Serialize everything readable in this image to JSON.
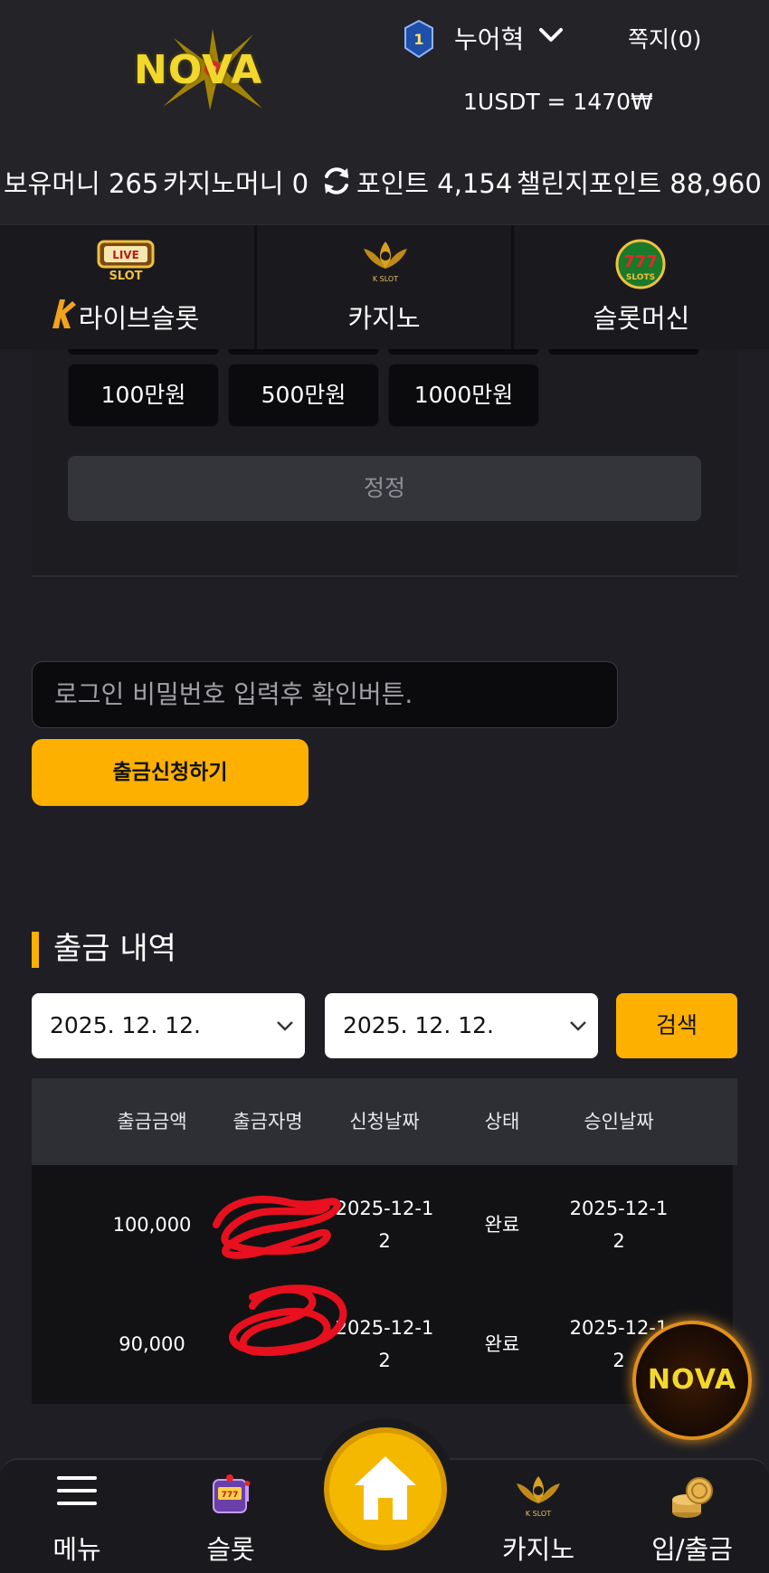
{
  "header": {
    "logo_text": "NOVA",
    "rank_level": "1",
    "user_name": "누어혁",
    "messages_label": "쪽지(0)",
    "exchange_rate": "1USDT = 1470₩"
  },
  "balances": {
    "holding_label": "보유머니 265",
    "casino_label": "카지노머니 0",
    "points_label": "포인트 4,154",
    "challenge_label": "챌린지포인트 88,960"
  },
  "categories": [
    {
      "label": "라이브슬롯",
      "icon": "live-slot-icon"
    },
    {
      "label": "카지노",
      "icon": "k-slot-lotus-icon"
    },
    {
      "label": "슬롯머신",
      "icon": "777-slots-icon"
    }
  ],
  "amount_buttons": [
    "100만원",
    "500만원",
    "1000만원"
  ],
  "reset_label": "정정",
  "password_placeholder": "로그인 비밀번호 입력후 확인버튼.",
  "withdraw_label": "출금신청하기",
  "history": {
    "title": "출금 내역",
    "date_from": "2025. 12. 12.",
    "date_to": "2025. 12. 12.",
    "search_label": "검색",
    "columns": [
      "출금금액",
      "출금자명",
      "신청날짜",
      "상태",
      "승인날짜"
    ],
    "rows": [
      {
        "amount": "100,000",
        "name": "",
        "request_date": "2025-12-12",
        "status": "완료",
        "approve_date": "2025-12-12"
      },
      {
        "amount": "90,000",
        "name": "",
        "request_date": "2025-12-12",
        "status": "완료",
        "approve_date": "2025-12-12"
      }
    ]
  },
  "float_logo_text": "NOVA",
  "bottom_nav": {
    "menu": "메뉴",
    "slot": "슬롯",
    "casino": "카지노",
    "deposit_withdraw": "입/출금"
  },
  "colors": {
    "accent": "#fdb000",
    "background": "#1e1e24",
    "logo_yellow": "#f2d82c"
  }
}
